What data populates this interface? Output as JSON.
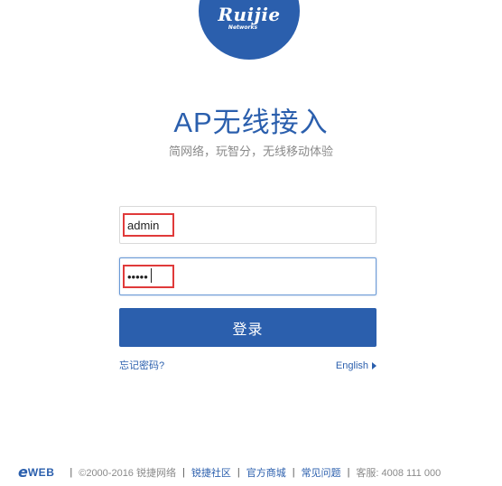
{
  "brand": {
    "name": "Ruijie",
    "sub": "Networks",
    "color": "#2b5fad"
  },
  "header": {
    "title": "AP无线接入",
    "subtitle": "简网络，玩智分，无线移动体验"
  },
  "form": {
    "username": "admin",
    "password": "*****",
    "login_label": "登录",
    "forgot_label": "忘记密码?",
    "language_label": "English"
  },
  "footer": {
    "logo_e": "e",
    "logo_text": "WEB",
    "copyright": "©2000-2016 锐捷网络",
    "links": [
      "锐捷社区",
      "官方商城",
      "常见问题"
    ],
    "service": "客服:  4008 111 000"
  },
  "colors": {
    "accent": "#2b5fad",
    "annotation": "#e03a3a"
  }
}
